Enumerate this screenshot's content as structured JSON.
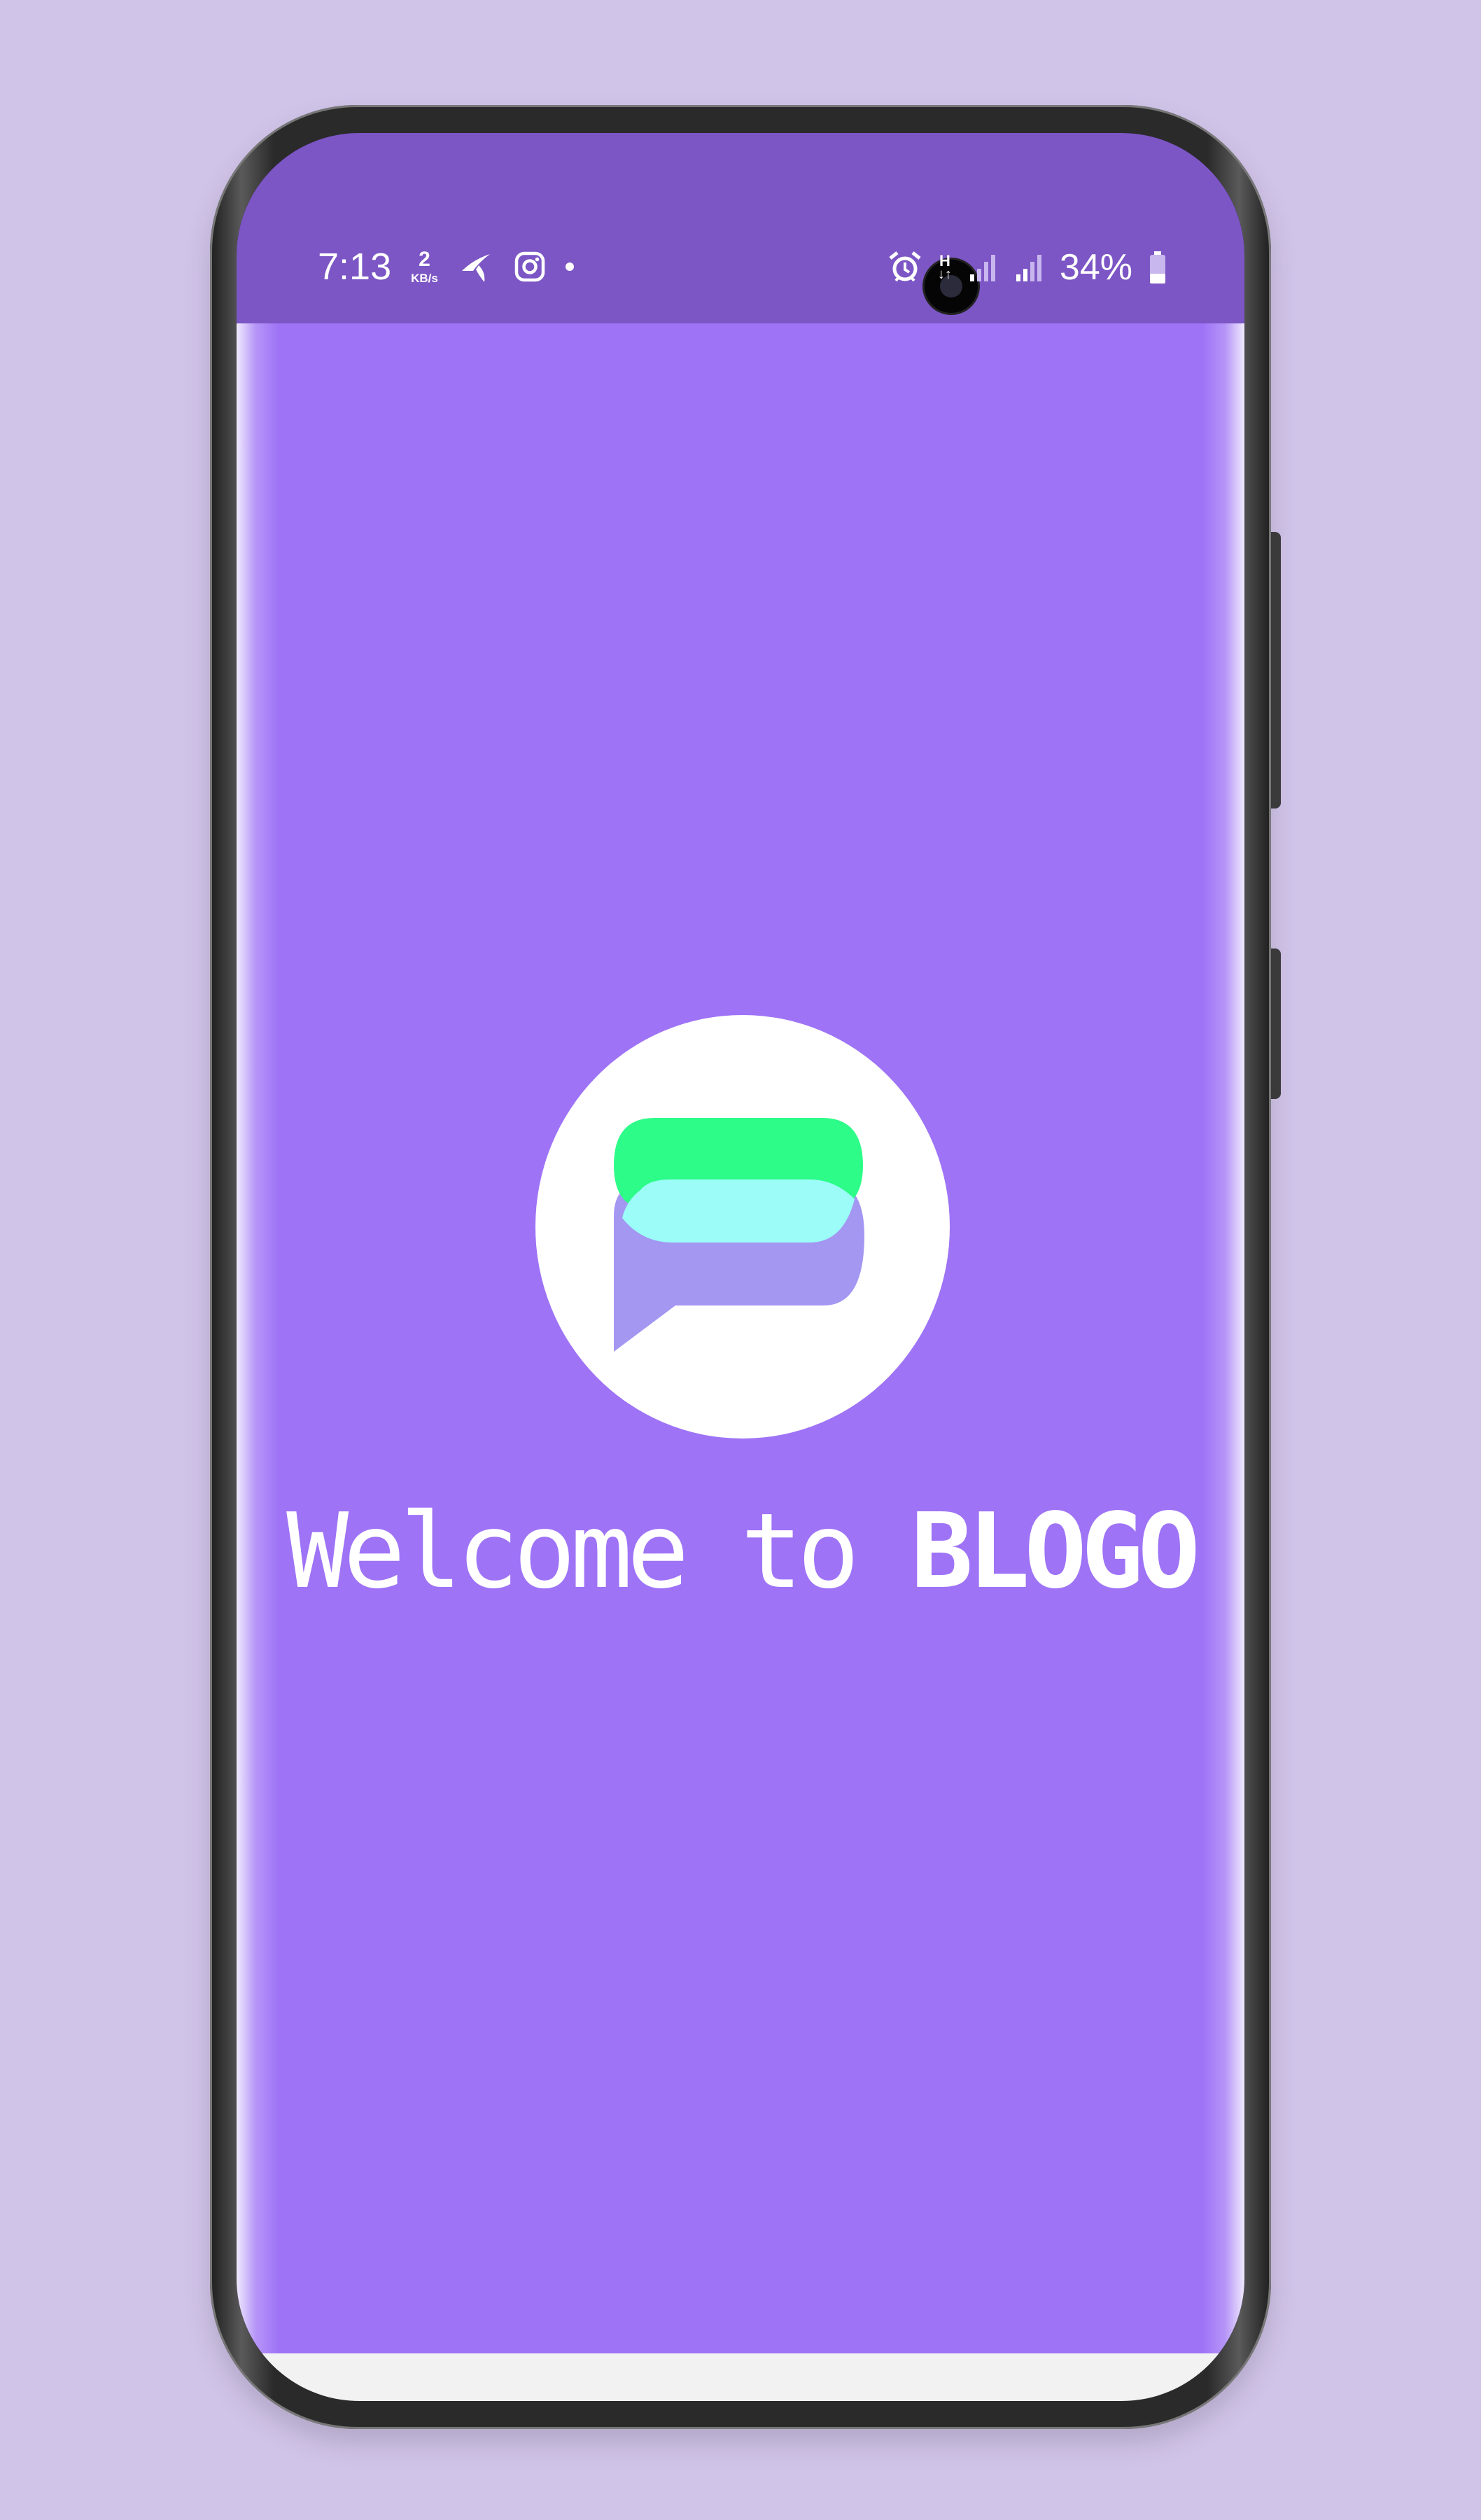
{
  "status_bar": {
    "time": "7:13",
    "net_speed_value": "2",
    "net_speed_unit": "KB/s",
    "network_type": "H",
    "battery_percent": "34%",
    "icons": [
      "telenor-icon",
      "instagram-icon",
      "notification-dot-icon",
      "alarm-icon",
      "data-arrows-icon",
      "signal-icon-1",
      "signal-icon-2",
      "battery-icon"
    ]
  },
  "app": {
    "welcome_prefix": "Welcome to ",
    "brand_name": "BLOGO",
    "logo": "blogo-chat-bubble-logo"
  },
  "nav_bar": {
    "buttons": [
      "recents-icon",
      "home-icon",
      "back-icon"
    ]
  },
  "colors": {
    "background": "#d1c4e9",
    "status_bar": "#7c56c5",
    "app_background": "#9e73f6",
    "logo_green": "#2dfc88",
    "logo_cyan": "#9bfcf8",
    "logo_lavender": "#a397f2",
    "nav_bar": "#f2f2f2"
  }
}
